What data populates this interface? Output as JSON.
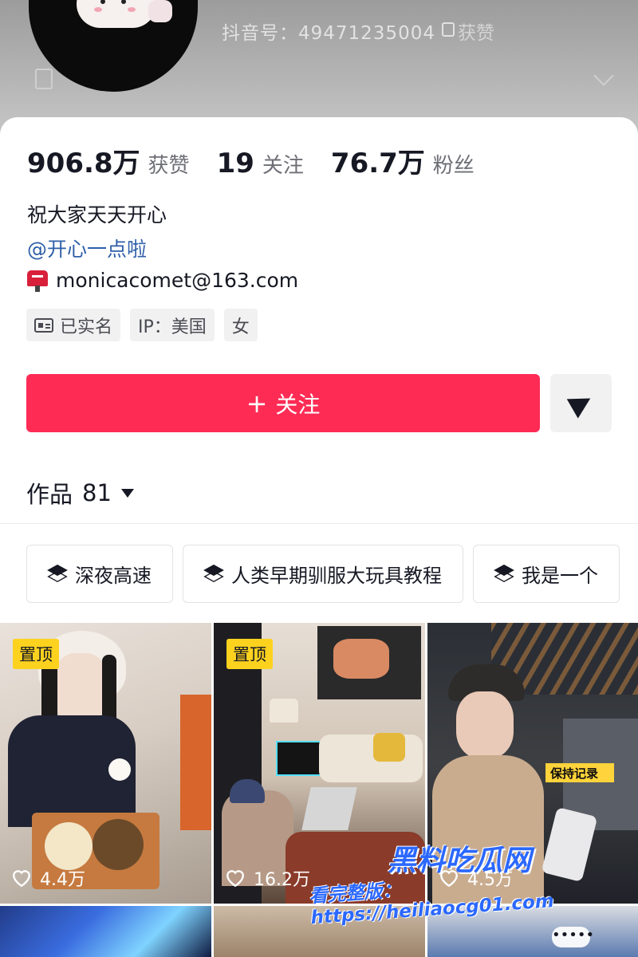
{
  "header": {
    "douyin_id": "抖音号：49471235004",
    "got_like_text": "获赞"
  },
  "stats": {
    "likes_value": "906.8万",
    "likes_label": "获赞",
    "following_value": "19",
    "following_label": "关注",
    "followers_value": "76.7万",
    "followers_label": "粉丝"
  },
  "profile": {
    "bio": "祝大家天天开心",
    "mention": "@开心一点啦",
    "email": "monicacomet@163.com",
    "tags": [
      "已实名",
      "IP：美国",
      "女"
    ]
  },
  "actions": {
    "follow_label": "关注"
  },
  "works": {
    "label": "作品",
    "count": "81"
  },
  "collections": [
    "深夜高速",
    "人类早期驯服大玩具教程",
    "我是一个"
  ],
  "videos": [
    {
      "pinned": "置顶",
      "likes": "4.4万"
    },
    {
      "pinned": "置顶",
      "likes": "16.2万"
    },
    {
      "pinned": "",
      "likes": "4.5万"
    }
  ],
  "watermark": {
    "line1": "黑料吃瓜网",
    "line2": "看完整版：https://heiliaocg01.com"
  },
  "colors": {
    "follow_button": "#fe2c55",
    "link": "#2f5fa8",
    "pin_badge": "#fdd21f"
  }
}
